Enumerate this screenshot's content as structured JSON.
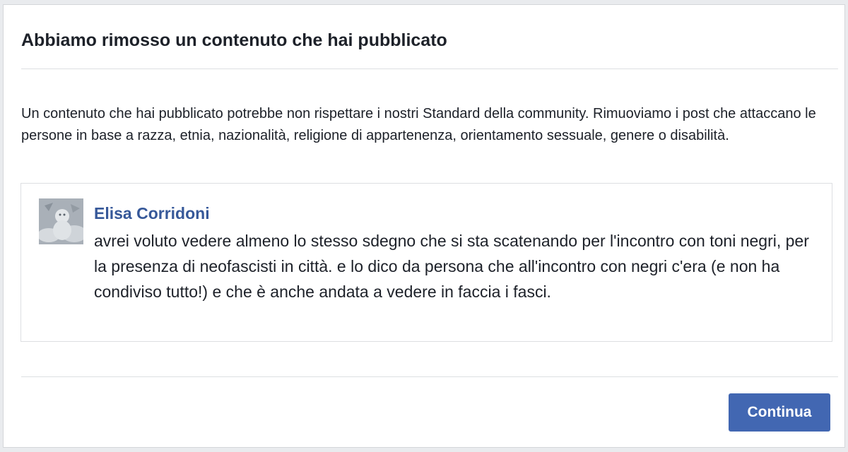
{
  "dialog": {
    "title": "Abbiamo rimosso un contenuto che hai pubblicato",
    "message": "Un contenuto che hai pubblicato potrebbe non rispettare i nostri Standard della community. Rimuoviamo i post che attaccano le persone in base a razza, etnia, nazionalità, religione di appartenenza, orientamento sessuale, genere o disabilità."
  },
  "post": {
    "author": "Elisa Corridoni",
    "avatar_icon": "profile-photo",
    "text": "avrei voluto vedere almeno lo stesso sdegno che si sta scatenando per l'incontro con toni negri, per la presenza di neofascisti in città. e lo dico da persona che all'incontro con negri c'era (e non ha condiviso tutto!) e che è anche andata a vedere in faccia i fasci."
  },
  "buttons": {
    "continue_label": "Continua"
  },
  "colors": {
    "primary": "#4267b2",
    "link": "#365899",
    "text": "#1d2129",
    "border": "#dddfe2"
  }
}
